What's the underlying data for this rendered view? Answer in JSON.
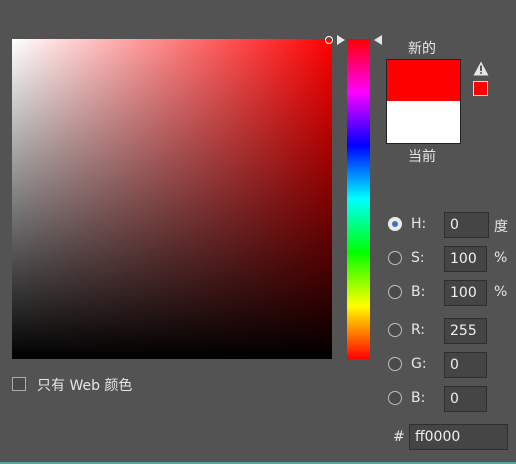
{
  "picker": {
    "new_label": "新的",
    "current_label": "当前",
    "new_color": "#ff0000",
    "current_color": "#ffffff",
    "hue_marker_fraction": 0.0
  },
  "hsb": {
    "h": {
      "label": "H:",
      "value": "0",
      "unit": "度",
      "selected": true
    },
    "s": {
      "label": "S:",
      "value": "100",
      "unit": "%",
      "selected": false
    },
    "b": {
      "label": "B:",
      "value": "100",
      "unit": "%",
      "selected": false
    }
  },
  "rgb": {
    "r": {
      "label": "R:",
      "value": "255"
    },
    "g": {
      "label": "G:",
      "value": "0"
    },
    "b": {
      "label": "B:",
      "value": "0"
    }
  },
  "hex": {
    "label": "#",
    "value": "ff0000"
  },
  "only_web_colors": {
    "label": "只有 Web 颜色",
    "checked": false
  },
  "icons": {
    "warning": "warning-triangle-icon",
    "websafe": "web-safe-swatch"
  }
}
